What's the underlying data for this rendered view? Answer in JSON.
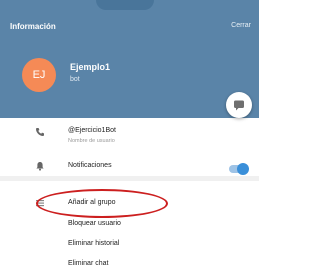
{
  "header": {
    "title": "Información",
    "close_label": "Cerrar"
  },
  "profile": {
    "initials": "EJ",
    "name": "Ejemplo1",
    "subtitle": "bot",
    "avatar_color": "#f58a56"
  },
  "info": {
    "username": "@Ejercicio1Bot",
    "username_caption": "Nombre de usuario"
  },
  "notifications": {
    "label": "Notificaciones",
    "enabled": true
  },
  "actions": [
    {
      "label": "Añadir al grupo",
      "highlighted": true
    },
    {
      "label": "Bloquear usuario"
    },
    {
      "label": "Eliminar historial"
    },
    {
      "label": "Eliminar chat"
    }
  ],
  "colors": {
    "header_bg": "#5a84a8",
    "accent": "#3a8fd9",
    "highlight": "#cc1f1f"
  },
  "icons": {
    "username": "at-phone-icon",
    "notifications": "bell-icon",
    "add_to_group": "list-icon",
    "message": "chat-bubble-icon"
  }
}
